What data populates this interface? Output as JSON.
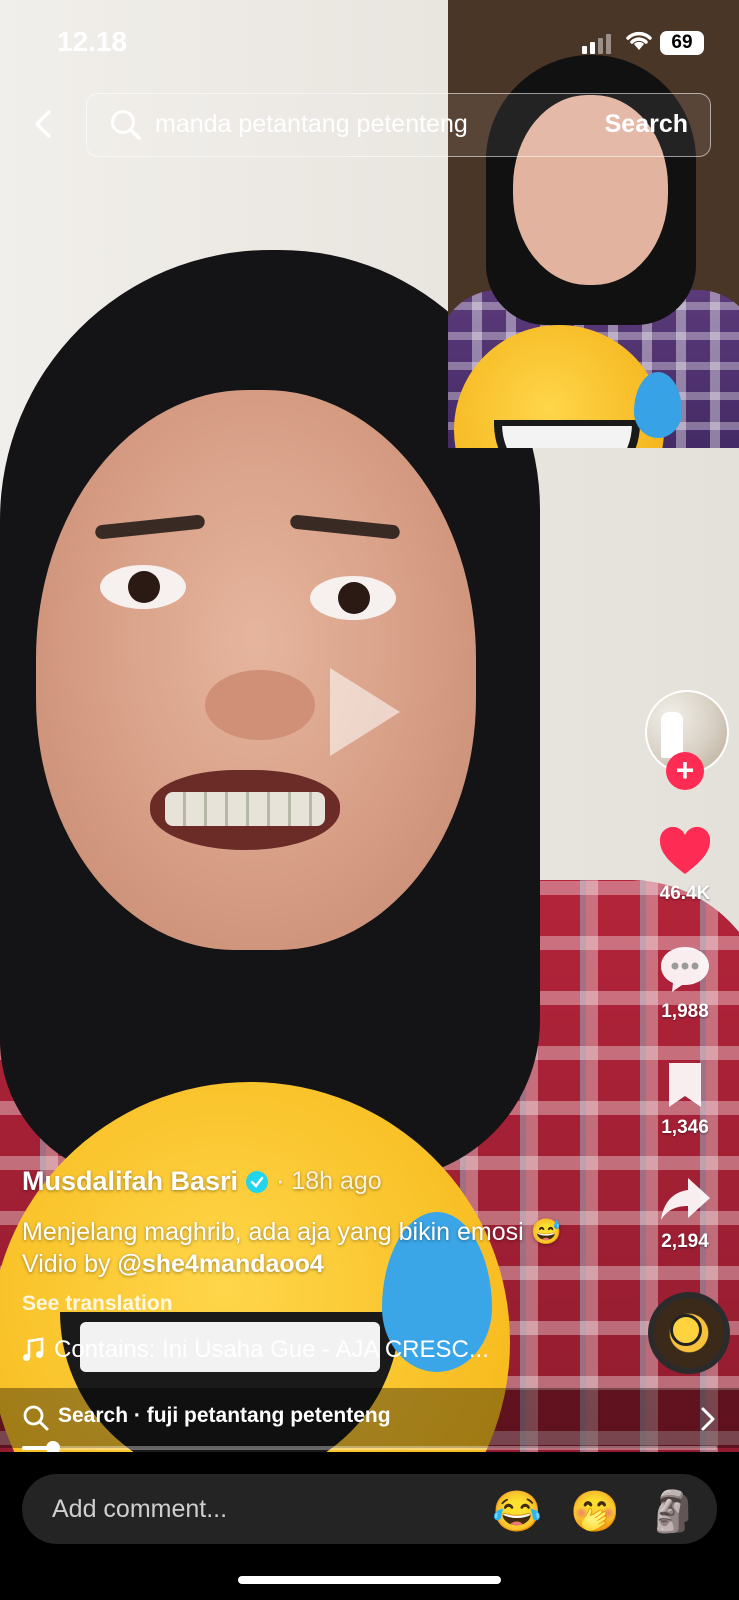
{
  "status_bar": {
    "time": "12.18",
    "battery": "69"
  },
  "search": {
    "query": "manda petantang petenteng",
    "button_label": "Search"
  },
  "actions": {
    "likes": "46.4K",
    "comments": "1,988",
    "saves": "1,346",
    "shares": "2,194"
  },
  "post": {
    "author": "Musdalifah Basri",
    "age": "· 18h ago",
    "caption_text": "Menjelang maghrib, ada aja yang bikin emosi 😅 Vidio by",
    "mention": "@she4mandaoo4",
    "see_translation": "See translation",
    "sound": "Contains: Ini Usaha Gue - AJA CRESC..."
  },
  "related_search": {
    "label": "Search · fuji petantang petenteng"
  },
  "playback": {
    "progress": 0.045
  },
  "comment_bar": {
    "placeholder": "Add comment...",
    "emojis": [
      "😂",
      "🤭",
      "🗿"
    ]
  },
  "colors": {
    "accent_red": "#fe2c55",
    "verified_blue": "#20d5ec"
  }
}
